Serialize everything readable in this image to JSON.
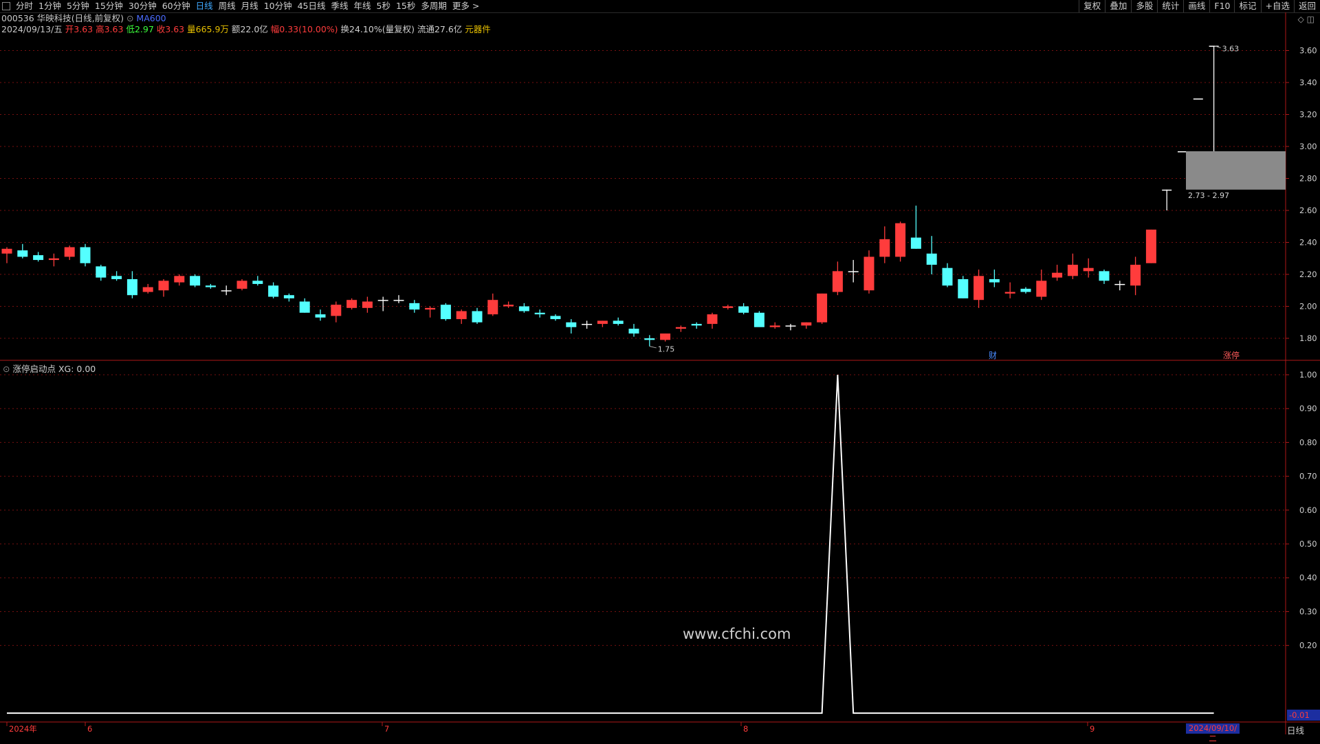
{
  "toolbar": {
    "tabs": [
      "分时",
      "1分钟",
      "5分钟",
      "15分钟",
      "30分钟",
      "60分钟",
      "日线",
      "周线",
      "月线",
      "10分钟",
      "45日线",
      "季线",
      "年线",
      "5秒",
      "15秒",
      "多周期",
      "更多 >"
    ],
    "active_tab": "日线",
    "right_buttons": [
      "复权",
      "叠加",
      "多股",
      "统计",
      "画线",
      "F10",
      "标记",
      "+自选",
      "返回"
    ]
  },
  "header": {
    "code": "000536",
    "name": "华映科技",
    "mode": "(日线,前复权)",
    "ma": "MA600",
    "date": "2024/09/13/五",
    "open_label": "开",
    "open": "3.63",
    "high_label": "高",
    "high": "3.63",
    "low_label": "低",
    "low": "2.97",
    "close_label": "收",
    "close": "3.63",
    "vol_label": "量",
    "vol": "665.9万",
    "amt_label": "额",
    "amt": "22.0亿",
    "chg_label": "幅",
    "chg": "0.33(10.00%)",
    "turnover_label": "换",
    "turnover": "24.10%(量复权)",
    "float_label": "流通",
    "float": "27.6亿",
    "extra": "元器件"
  },
  "price_axis": [
    "3.60",
    "3.40",
    "3.20",
    "3.00",
    "2.80",
    "2.60",
    "2.40",
    "2.20",
    "2.00",
    "1.80"
  ],
  "indicator": {
    "name": "涨停启动点",
    "label": "XG: 0.00",
    "axis": [
      "1.00",
      "0.90",
      "0.80",
      "0.70",
      "0.60",
      "0.50",
      "0.40",
      "0.30",
      "0.20"
    ],
    "min_label": "-0.01"
  },
  "annotations": {
    "low_marker": "1.75",
    "high_marker": "3.63",
    "range_label": "2.73 - 2.97",
    "cai": "财",
    "zhangting": "涨停"
  },
  "time_axis": [
    "2024年",
    "6",
    "7",
    "8",
    "9"
  ],
  "current_date": "2024/09/10/二",
  "period": "日线",
  "watermark": "www.cfchi.com",
  "colors": {
    "up": "#ff3c3c",
    "down": "#54ffff",
    "doji": "#ffffff",
    "grid": "#7a1010",
    "line": "#ffffff"
  },
  "chart_data": {
    "type": "candlestick",
    "candles": [
      [
        2.33,
        2.37,
        2.27,
        2.36
      ],
      [
        2.35,
        2.39,
        2.3,
        2.31
      ],
      [
        2.32,
        2.34,
        2.28,
        2.29
      ],
      [
        2.29,
        2.33,
        2.25,
        2.3
      ],
      [
        2.31,
        2.38,
        2.29,
        2.37
      ],
      [
        2.37,
        2.39,
        2.25,
        2.27
      ],
      [
        2.25,
        2.26,
        2.16,
        2.18
      ],
      [
        2.19,
        2.22,
        2.16,
        2.17
      ],
      [
        2.17,
        2.22,
        2.05,
        2.07
      ],
      [
        2.09,
        2.14,
        2.08,
        2.12
      ],
      [
        2.1,
        2.17,
        2.06,
        2.16
      ],
      [
        2.15,
        2.2,
        2.13,
        2.19
      ],
      [
        2.19,
        2.2,
        2.12,
        2.13
      ],
      [
        2.13,
        2.14,
        2.11,
        2.12
      ],
      [
        2.1,
        2.13,
        2.07,
        2.1
      ],
      [
        2.11,
        2.17,
        2.1,
        2.16
      ],
      [
        2.16,
        2.19,
        2.13,
        2.14
      ],
      [
        2.13,
        2.15,
        2.05,
        2.06
      ],
      [
        2.07,
        2.08,
        2.03,
        2.05
      ],
      [
        2.03,
        2.05,
        1.96,
        1.96
      ],
      [
        1.95,
        1.98,
        1.91,
        1.93
      ],
      [
        1.94,
        2.03,
        1.9,
        2.01
      ],
      [
        1.99,
        2.05,
        1.98,
        2.04
      ],
      [
        1.99,
        2.06,
        1.96,
        2.03
      ],
      [
        2.04,
        2.06,
        1.97,
        2.04
      ],
      [
        2.04,
        2.07,
        2.02,
        2.04
      ],
      [
        2.02,
        2.04,
        1.96,
        1.98
      ],
      [
        1.98,
        2.0,
        1.93,
        1.99
      ],
      [
        2.01,
        2.02,
        1.91,
        1.92
      ],
      [
        1.92,
        1.98,
        1.89,
        1.97
      ],
      [
        1.97,
        1.99,
        1.89,
        1.9
      ],
      [
        1.95,
        2.08,
        1.94,
        2.04
      ],
      [
        2.0,
        2.03,
        1.99,
        2.01
      ],
      [
        2.0,
        2.02,
        1.96,
        1.97
      ],
      [
        1.96,
        1.98,
        1.93,
        1.95
      ],
      [
        1.94,
        1.95,
        1.91,
        1.92
      ],
      [
        1.9,
        1.92,
        1.83,
        1.87
      ],
      [
        1.89,
        1.91,
        1.86,
        1.89
      ],
      [
        1.89,
        1.91,
        1.87,
        1.91
      ],
      [
        1.91,
        1.93,
        1.88,
        1.89
      ],
      [
        1.86,
        1.89,
        1.81,
        1.83
      ],
      [
        1.8,
        1.82,
        1.75,
        1.79
      ],
      [
        1.79,
        1.83,
        1.78,
        1.83
      ],
      [
        1.86,
        1.88,
        1.84,
        1.87
      ],
      [
        1.89,
        1.9,
        1.86,
        1.88
      ],
      [
        1.89,
        1.96,
        1.86,
        1.95
      ],
      [
        1.99,
        2.01,
        1.98,
        2.0
      ],
      [
        2.0,
        2.02,
        1.95,
        1.96
      ],
      [
        1.96,
        1.97,
        1.88,
        1.87
      ],
      [
        1.87,
        1.9,
        1.86,
        1.88
      ],
      [
        1.88,
        1.89,
        1.85,
        1.88
      ],
      [
        1.88,
        1.9,
        1.86,
        1.9
      ],
      [
        1.9,
        2.08,
        1.89,
        2.08
      ],
      [
        2.09,
        2.28,
        2.07,
        2.22
      ],
      [
        2.22,
        2.29,
        2.15,
        2.22
      ],
      [
        2.1,
        2.35,
        2.08,
        2.31
      ],
      [
        2.31,
        2.5,
        2.27,
        2.42
      ],
      [
        2.31,
        2.53,
        2.28,
        2.52
      ],
      [
        2.43,
        2.63,
        2.36,
        2.36
      ],
      [
        2.33,
        2.44,
        2.2,
        2.26
      ],
      [
        2.24,
        2.27,
        2.12,
        2.13
      ],
      [
        2.17,
        2.19,
        2.05,
        2.05
      ],
      [
        2.04,
        2.23,
        1.99,
        2.19
      ],
      [
        2.17,
        2.23,
        2.12,
        2.15
      ],
      [
        2.08,
        2.15,
        2.05,
        2.09
      ],
      [
        2.11,
        2.12,
        2.08,
        2.09
      ],
      [
        2.06,
        2.23,
        2.04,
        2.16
      ],
      [
        2.18,
        2.26,
        2.16,
        2.21
      ],
      [
        2.19,
        2.33,
        2.17,
        2.26
      ],
      [
        2.22,
        2.3,
        2.18,
        2.24
      ],
      [
        2.22,
        2.23,
        2.14,
        2.16
      ],
      [
        2.14,
        2.16,
        2.1,
        2.14
      ],
      [
        2.13,
        2.31,
        2.07,
        2.26
      ],
      [
        2.27,
        2.48,
        2.27,
        2.48
      ],
      [
        2.73,
        2.73,
        2.6,
        2.73
      ],
      [
        2.97,
        2.97,
        2.97,
        2.97
      ],
      [
        3.3,
        3.3,
        3.3,
        3.3
      ],
      [
        3.63,
        3.63,
        2.97,
        3.63
      ]
    ],
    "indicator_values_peak_index": 53,
    "ylim": [
      1.7,
      3.68
    ],
    "indicator_ylim": [
      -0.01,
      1.0
    ]
  }
}
